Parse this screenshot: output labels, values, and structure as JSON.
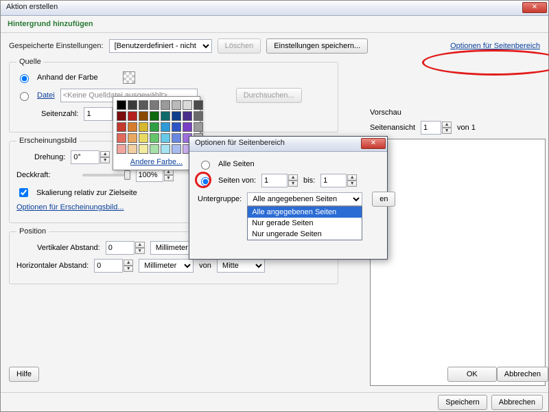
{
  "window": {
    "title": "Aktion erstellen"
  },
  "subheader": "Hintergrund hinzufügen",
  "savedSettings": {
    "label": "Gespeicherte Einstellungen:",
    "value": "[Benutzerdefiniert - nicht gespeichert]",
    "deleteBtn": "Löschen",
    "saveBtn": "Einstellungen speichern...",
    "pageRangeLink": "Optionen für Seitenbereich"
  },
  "source": {
    "legend": "Quelle",
    "byColorLabel": "Anhand der Farbe",
    "fileLabel": "Datei",
    "fileValue": "<Keine Quelldatei ausgewählt>",
    "browseBtn": "Durchsuchen...",
    "pageCountLabel": "Seitenzahl:",
    "pageCountValue": "1"
  },
  "colorPopup": {
    "otherLabel": "Andere Farbe...",
    "colors": [
      "#000000",
      "#3b3b3b",
      "#5a5a5a",
      "#7a7a7a",
      "#9a9a9a",
      "#bababa",
      "#dadada",
      "#4b4b4b",
      "#7a0d0d",
      "#b51f1f",
      "#8a4a00",
      "#0f6a0f",
      "#0f6a6a",
      "#0f3f8a",
      "#4a2f8a",
      "#6a6a6a",
      "#c43a2e",
      "#d67d2e",
      "#d6b82e",
      "#2ea043",
      "#2e9ad6",
      "#2e55c4",
      "#7a3ec4",
      "#9a9a9a",
      "#e06a5e",
      "#e8a860",
      "#e8da60",
      "#66c46a",
      "#66c9e8",
      "#6a88e0",
      "#a070e0",
      "#bcbcbc",
      "#f0a69e",
      "#f2cfa0",
      "#f2eca0",
      "#a6e0a8",
      "#a6e3f2",
      "#a8bcf0",
      "#cbb0f0",
      "#eeeeee"
    ]
  },
  "appearance": {
    "legend": "Erscheinungsbild",
    "rotationLabel": "Drehung:",
    "rotationValue": "0°",
    "opacityLabel": "Deckkraft:",
    "opacityValue": "100%",
    "scaleLabel": "Skalierung relativ zur Zielseite",
    "optionsLink": "Optionen für Erscheinungsbild..."
  },
  "position": {
    "legend": "Position",
    "vLabel": "Vertikaler Abstand:",
    "hLabel": "Horizontaler Abstand:",
    "value": "0",
    "unit": "Millimeter",
    "fromLabel": "von",
    "fromValue": "Mitte"
  },
  "preview": {
    "legend": "Vorschau",
    "pageViewLabel": "Seitenansicht",
    "pageValue": "1",
    "ofLabel": "von 1"
  },
  "footer": {
    "helpBtn": "Hilfe",
    "okBtn": "OK",
    "cancelBtn": "Abbrechen"
  },
  "bottom": {
    "saveBtn": "Speichern",
    "cancelBtn": "Abbrechen"
  },
  "dialog": {
    "title": "Optionen für Seitenbereich",
    "allPages": "Alle Seiten",
    "pagesFrom": "Seiten von:",
    "fromValue": "1",
    "toLabel": "bis:",
    "toValue": "1",
    "subsetLabel": "Untergruppe:",
    "subsetValue": "Alle angegebenen Seiten",
    "options": [
      "Alle angegebenen Seiten",
      "Nur gerade Seiten",
      "Nur ungerade Seiten"
    ],
    "okHint": "en"
  }
}
